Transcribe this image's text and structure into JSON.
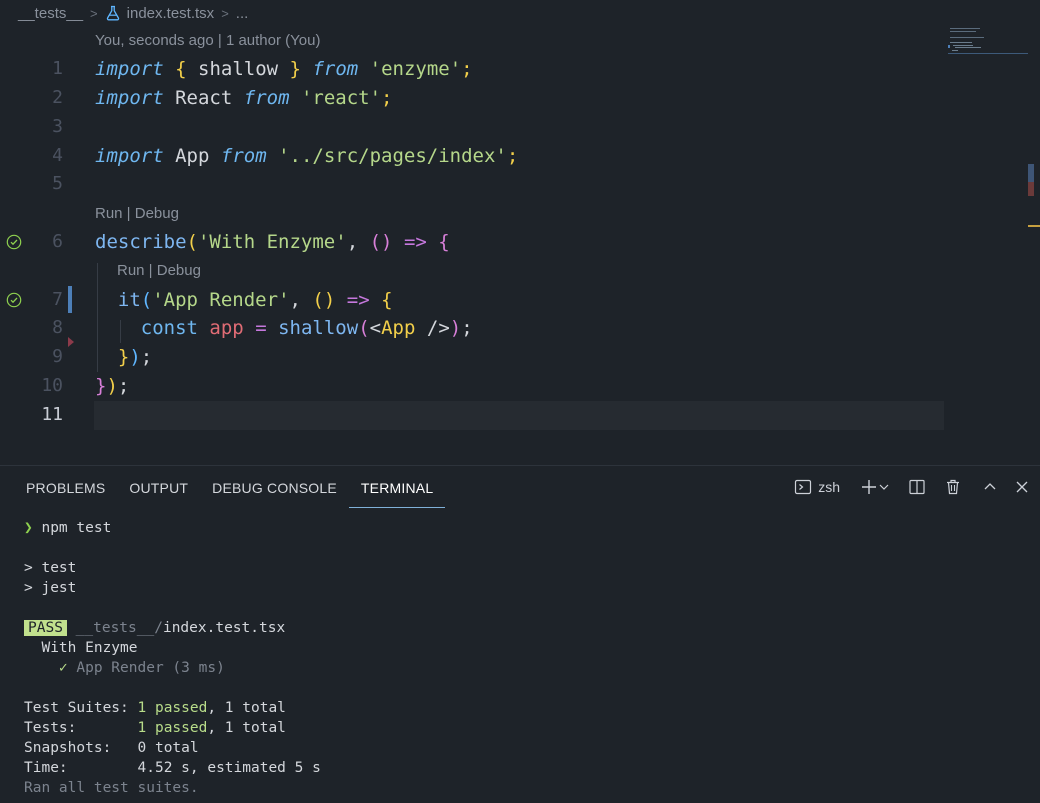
{
  "breadcrumb": {
    "folder": "__tests__",
    "file": "index.test.tsx",
    "more": "..."
  },
  "editor": {
    "blame": "You, seconds ago | 1 author (You)",
    "codelens_describe": "Run | Debug",
    "codelens_it": "Run | Debug",
    "line_numbers": [
      "1",
      "2",
      "3",
      "4",
      "5",
      "6",
      "7",
      "8",
      "9",
      "10",
      "11"
    ]
  },
  "panel": {
    "tabs": [
      "PROBLEMS",
      "OUTPUT",
      "DEBUG CONSOLE",
      "TERMINAL"
    ],
    "active_tab": "TERMINAL",
    "shell": "zsh"
  },
  "terminal": {
    "prompt_symbol": "❯",
    "command": "npm test",
    "script_line_1": "> test",
    "script_line_2": "> jest",
    "pass_badge": "PASS",
    "test_dir": "__tests__/",
    "test_file": "index.test.tsx",
    "suite_name": "With Enzyme",
    "check_mark": "✓",
    "test_name": "App Render (3 ms)",
    "suites_label": "Test Suites:",
    "suites_passed": "1 passed",
    "suites_total": ", 1 total",
    "tests_label": "Tests:",
    "tests_passed": "1 passed",
    "tests_total": ", 1 total",
    "snapshots_label": "Snapshots:",
    "snapshots_value": "0 total",
    "time_label": "Time:",
    "time_value": "4.52 s, estimated 5 s",
    "footer": "Ran all test suites."
  },
  "colors": {
    "background": "#1e2329",
    "keyword": "#6fb7f0",
    "string": "#b5d78a",
    "pass_badge": "#c1e08d",
    "prompt": "#8fd14f"
  }
}
